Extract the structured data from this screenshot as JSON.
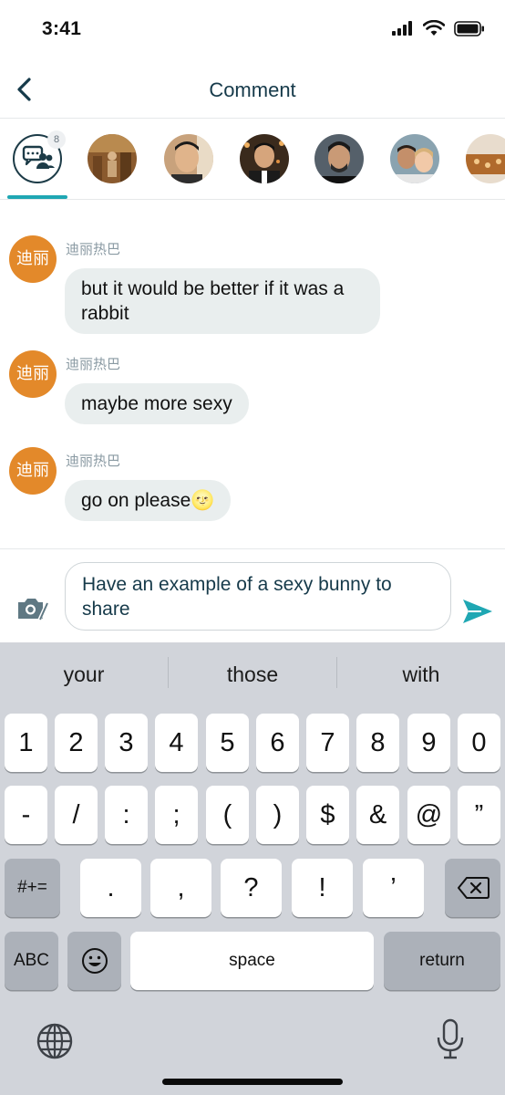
{
  "status_bar": {
    "time": "3:41"
  },
  "header": {
    "title": "Comment"
  },
  "participants": {
    "group_badge_count": "8"
  },
  "messages": [
    {
      "avatar_text": "迪丽",
      "sender": "迪丽热巴",
      "text": "but it would be better if it was a rabbit"
    },
    {
      "avatar_text": "迪丽",
      "sender": "迪丽热巴",
      "text": "maybe more sexy"
    },
    {
      "avatar_text": "迪丽",
      "sender": "迪丽热巴",
      "text": "go on please🌝"
    }
  ],
  "composer": {
    "input_value": "Have an example of a sexy bunny to share"
  },
  "keyboard": {
    "suggestions": [
      "your",
      "those",
      "with"
    ],
    "row1": [
      "1",
      "2",
      "3",
      "4",
      "5",
      "6",
      "7",
      "8",
      "9",
      "0"
    ],
    "row2": [
      "-",
      "/",
      ":",
      ";",
      "(",
      ")",
      "$",
      "&",
      "@",
      "”"
    ],
    "row3_left": "#+=",
    "row3": [
      ".",
      ",",
      "?",
      "!",
      "’"
    ],
    "abc": "ABC",
    "space": "space",
    "return": "return"
  },
  "colors": {
    "accent": "#1fa7b3",
    "avatar_orange": "#e3892a",
    "bubble": "#e9eeee",
    "title": "#163a4a"
  },
  "icons": [
    "signal-icon",
    "wifi-icon",
    "battery-icon",
    "back-chevron-icon",
    "group-chat-icon",
    "camera-icon",
    "send-icon",
    "backspace-icon",
    "emoji-icon",
    "globe-icon",
    "microphone-icon"
  ]
}
